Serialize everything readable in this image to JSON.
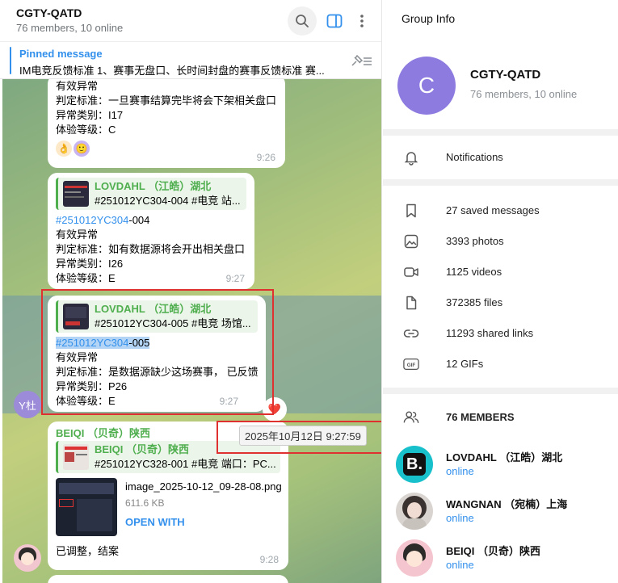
{
  "header": {
    "title": "CGTY-QATD",
    "subtitle": "76 members, 10 online",
    "search_icon": "search-icon",
    "panel_icon": "sidebar-toggle-icon",
    "more_icon": "more-vertical-icon"
  },
  "pinned": {
    "title": "Pinned message",
    "text": "IM电竞反馈标准 1、赛事无盘口、长时间封盘的赛事反馈标准 赛..."
  },
  "messages": [
    {
      "lines": [
        "有效异常",
        "判定标准：一旦赛事结算完毕将会下架相关盘口",
        "异常类别：I17",
        "体验等级：C"
      ],
      "reactions": [
        "👌",
        "🙂"
      ],
      "time": "9:26"
    },
    {
      "reply_name": "LOVDAHL （江皓）湖北",
      "reply_text": "#251012YC304-004 #电竞 站...",
      "tag": "#251012YC304",
      "tag_suffix": "-004",
      "lines": [
        "有效异常",
        "判定标准：如有数据源将会开出相关盘口",
        "异常类别：I26",
        "体验等级：E"
      ],
      "time": "9:27"
    },
    {
      "reply_name": "LOVDAHL （江皓）湖北",
      "reply_text": "#251012YC304-005 #电竞 场馆...",
      "tag": "#251012YC304",
      "tag_suffix": "-005",
      "lines": [
        "有效异常",
        "判定标准：是数据源缺少这场赛事， 已反馈",
        "异常类别：P26",
        "体验等级：E"
      ],
      "time": "9:27",
      "avatar_text": "Y杜",
      "reaction": "❤️"
    },
    {
      "sender": "BEIQI （贝奇）陕西",
      "reply_name": "BEIQI （贝奇）陕西",
      "reply_text": "#251012YC328-001 #电竞 端口：PC...",
      "file_name": "image_2025-10-12_09-28-08.png",
      "file_size": "611.6 KB",
      "file_action": "OPEN WITH",
      "text": "已调整，结案",
      "time": "9:28"
    }
  ],
  "date_tooltip": "2025年10月12日 9:27:59",
  "info": {
    "title": "Group Info",
    "group_initial": "C",
    "group_name": "CGTY-QATD",
    "group_sub": "76 members, 10 online",
    "notifications": "Notifications",
    "stats": [
      {
        "icon": "bookmark-icon",
        "label": "27 saved messages"
      },
      {
        "icon": "photo-icon",
        "label": "3393 photos"
      },
      {
        "icon": "video-icon",
        "label": "1125 videos"
      },
      {
        "icon": "file-icon",
        "label": "372385 files"
      },
      {
        "icon": "link-icon",
        "label": "11293 shared links"
      },
      {
        "icon": "gif-icon",
        "label": "12 GIFs"
      }
    ],
    "members_label": "76 MEMBERS",
    "members": [
      {
        "name": "LOVDAHL （江皓）湖北",
        "status": "online"
      },
      {
        "name": "WANGNAN （宛楠）上海",
        "status": "online"
      },
      {
        "name": "BEIQI （贝奇）陕西",
        "status": "online"
      }
    ]
  },
  "colors": {
    "accent": "#3390ec",
    "sender_green": "#4fae4e",
    "highlight_red": "#e03131",
    "group_avatar": "#8d7be0"
  }
}
